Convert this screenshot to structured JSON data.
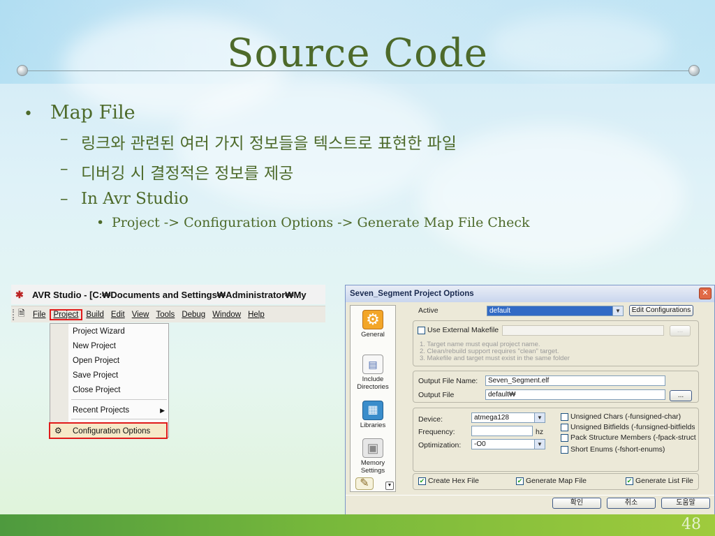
{
  "slide": {
    "title": "Source Code",
    "page_number": "48",
    "bullets": {
      "level1": "Map File",
      "items": [
        "링크와 관련된 여러 가지 정보들을 텍스트로 표현한 파일",
        "디버깅 시 결정적은 정보를 제공",
        "In Avr Studio"
      ],
      "sub": "Project -> Configuration Options -> Generate Map File Check"
    }
  },
  "avr_studio": {
    "title": "AVR Studio - [C:₩Documents and Settings₩Administrator₩My",
    "menu": [
      "File",
      "Project",
      "Build",
      "Edit",
      "View",
      "Tools",
      "Debug",
      "Window",
      "Help"
    ],
    "project_menu": {
      "items": [
        "Project Wizard",
        "New Project",
        "Open Project",
        "Save Project",
        "Close Project"
      ],
      "recent": "Recent Projects",
      "config": "Configuration Options"
    }
  },
  "dialog": {
    "title": "Seven_Segment Project Options",
    "sidebar": [
      "General",
      "Include Directories",
      "Libraries",
      "Memory Settings"
    ],
    "active_label": "Active",
    "active_value": "default",
    "edit_config_btn": "Edit Configurations",
    "use_external_makefile": "Use External Makefile",
    "browse_btn": "...",
    "hints": [
      "1. Target name must equal project name.",
      "2. Clean/rebuild support requires  \"clean\" target.",
      "3. Makefile and target must exist in the same folder"
    ],
    "output_file_name_label": "Output File Name:",
    "output_file_name": "Seven_Segment.elf",
    "output_file_label": "Output File",
    "output_file": "default₩",
    "device_label": "Device:",
    "device": "atmega128",
    "frequency_label": "Frequency:",
    "frequency_unit": "hz",
    "optimization_label": "Optimization:",
    "optimization": "-O0",
    "options": [
      "Unsigned Chars (-funsigned-char)",
      "Unsigned Bitfields (-funsigned-bitfields",
      "Pack Structure Members (-fpack-struct)",
      "Short Enums (-fshort-enums)"
    ],
    "create_hex": "Create Hex File",
    "generate_map": "Generate Map File",
    "generate_list": "Generate List File",
    "ok_btn": "확인",
    "cancel_btn": "취소",
    "help_btn": "도움말"
  },
  "colors": {
    "title_green": "#4d6a2a",
    "highlight_red": "#e01a1a",
    "footer_green": "#77b83b"
  }
}
